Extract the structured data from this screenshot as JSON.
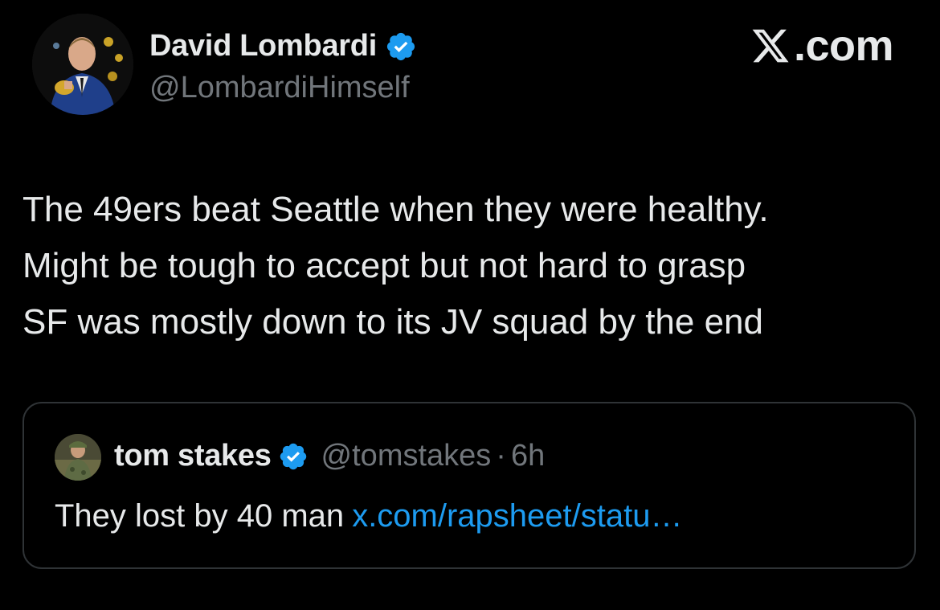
{
  "colors": {
    "background": "#000000",
    "text_primary": "#e7e9ea",
    "text_secondary": "#71767b",
    "verified_blue": "#1d9bf0",
    "link": "#1d9bf0",
    "border": "#2f3336"
  },
  "brand": {
    "text": ".com",
    "icon": "x-logo-icon"
  },
  "tweet": {
    "author": {
      "name": "David Lombardi",
      "handle": "@LombardiHimself",
      "verified": true,
      "avatar_icon": "avatar-photo"
    },
    "text_lines": [
      "The 49ers beat Seattle when they were healthy.",
      "Might be tough to accept but not hard to grasp",
      "SF was mostly down to its JV squad by the end"
    ]
  },
  "quoted_tweet": {
    "author": {
      "name": "tom stakes",
      "handle": "@tomstakes",
      "verified": true,
      "avatar_icon": "avatar-photo"
    },
    "separator": "·",
    "time": "6h",
    "text": "They lost by 40 man",
    "link": "x.com/rapsheet/statu…"
  }
}
